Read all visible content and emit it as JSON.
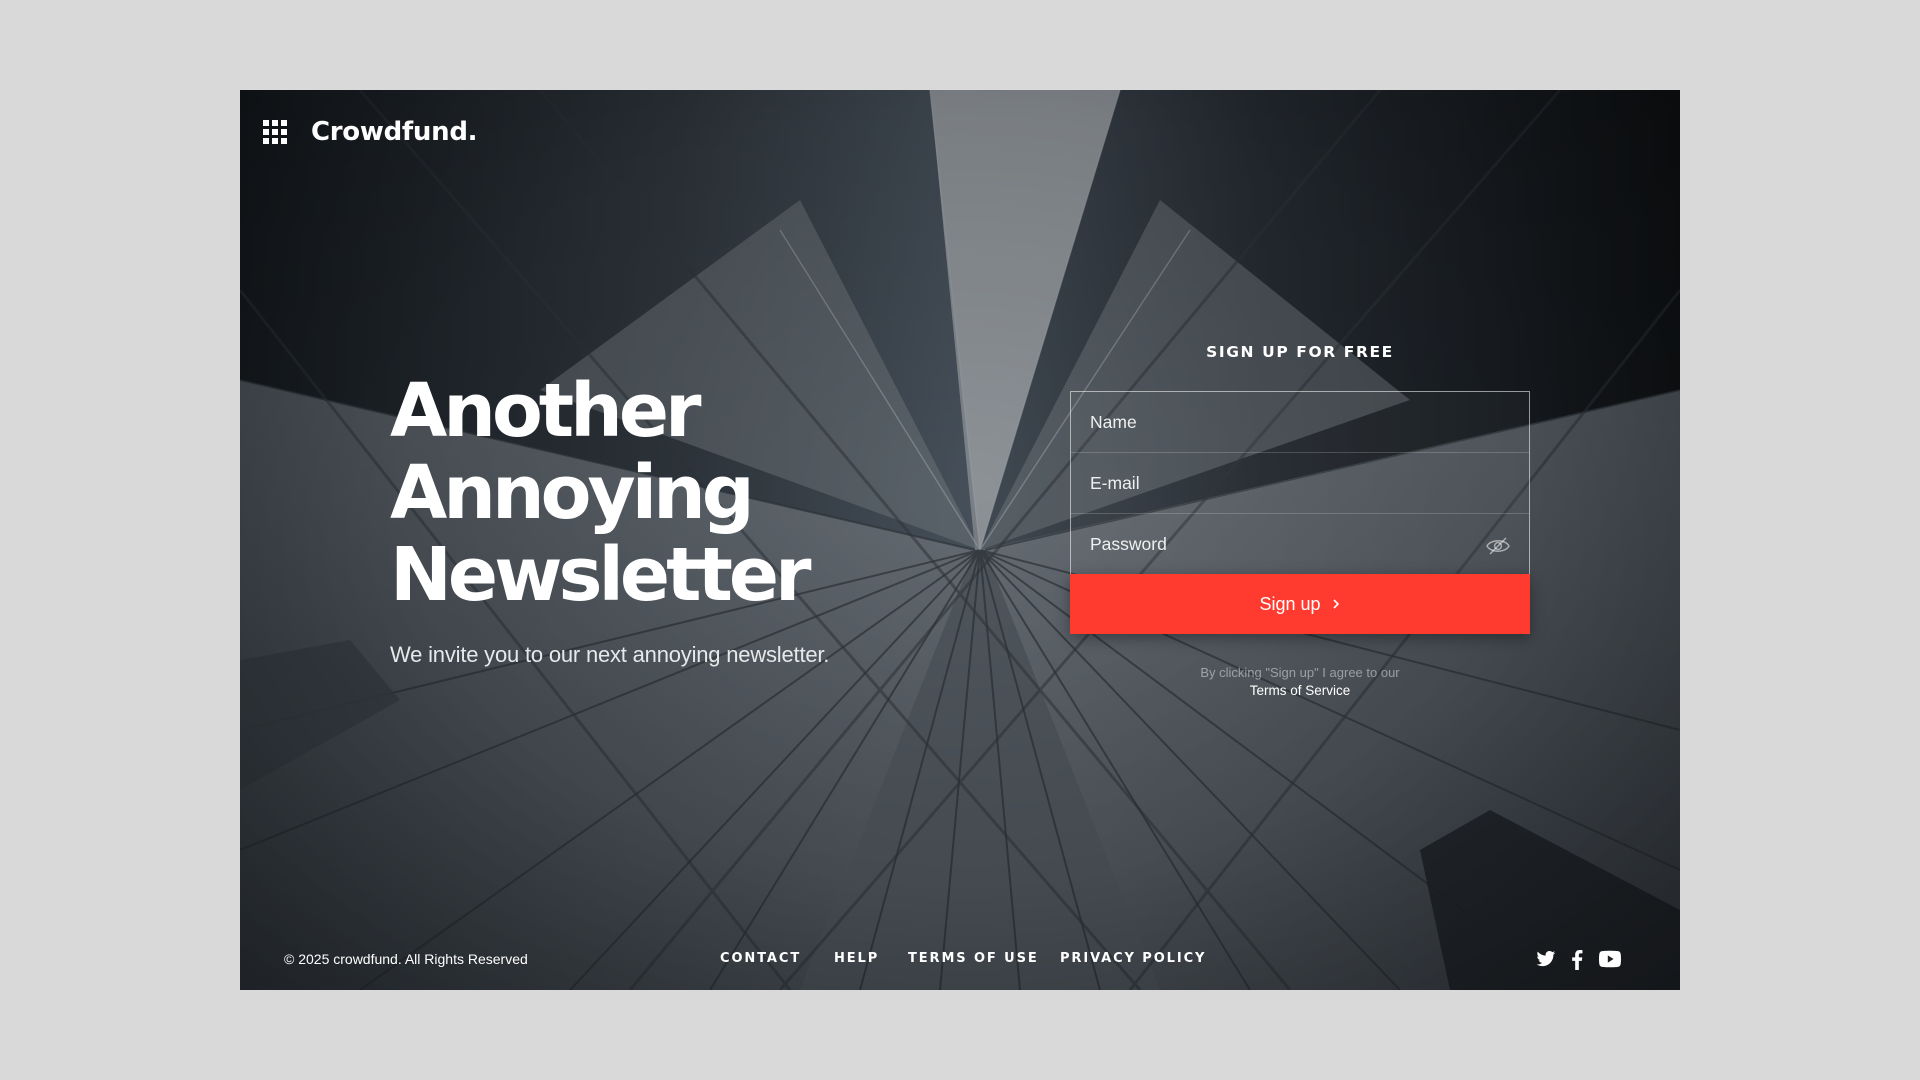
{
  "brand": {
    "name": "Crowdfund."
  },
  "hero": {
    "title_lines": [
      "Another",
      "Annoying",
      "Newsletter"
    ],
    "subtitle": "We invite you to our next annoying newsletter."
  },
  "signup": {
    "heading": "SIGN UP FOR FREE",
    "name_placeholder": "Name",
    "email_placeholder": "E-mail",
    "password_placeholder": "Password",
    "button_label": "Sign up",
    "agree_text": "By clicking \"Sign up\" I agree to our",
    "terms_link": "Terms of Service"
  },
  "footer": {
    "copyright": "© 2025 crowdfund. All Rights Reserved",
    "nav": [
      "CONTACT",
      "HELP",
      "TERMS OF USE",
      "PRIVACY POLICY"
    ],
    "social": [
      "twitter-icon",
      "facebook-icon",
      "youtube-icon"
    ]
  },
  "colors": {
    "accent": "#ff3b30",
    "text": "#ffffff",
    "page_background": "#d9d9d9"
  },
  "icons": {
    "menu": "grid-icon",
    "password_toggle": "eye-off-icon",
    "button_arrow": "chevron-right-icon"
  }
}
